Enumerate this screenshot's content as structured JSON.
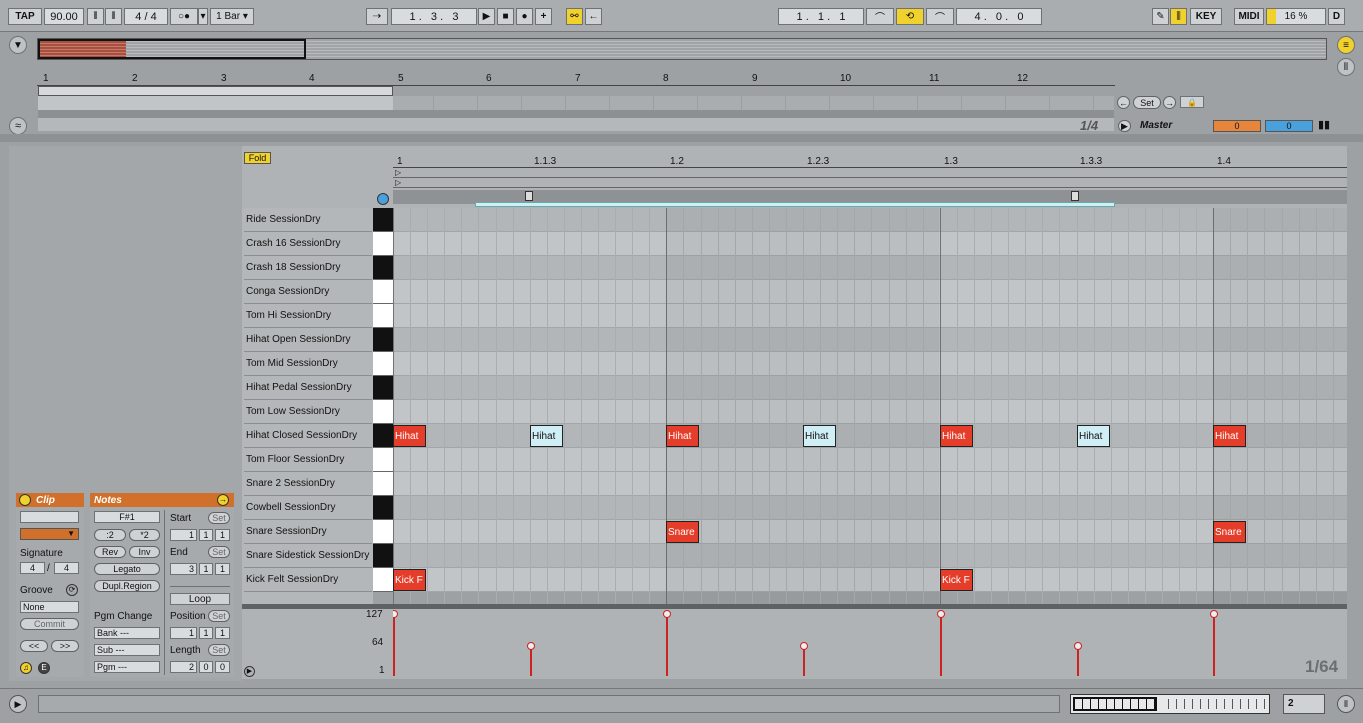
{
  "transport": {
    "tap": "TAP",
    "tempo": "90.00",
    "signature": "4 / 4",
    "quantize": "1 Bar",
    "song_position": "1 .   3 .   3",
    "loop_start": "1 .   1 .   1",
    "loop_length": "4 .   0 .   0",
    "key": "KEY",
    "midi": "MIDI",
    "cpu": "16 %",
    "d": "D"
  },
  "overview": {
    "ruler": [
      "1",
      "2",
      "3",
      "4",
      "5",
      "6",
      "7",
      "8",
      "9",
      "10",
      "11",
      "12"
    ],
    "set_button": "Set",
    "page": "1/4",
    "master": "Master",
    "master_value_a": "0",
    "master_value_b": "0"
  },
  "editor": {
    "fold": "Fold",
    "ruler": [
      "1",
      "1.1.3",
      "1.2",
      "1.2.3",
      "1.3",
      "1.3.3",
      "1.4"
    ],
    "keys": [
      {
        "name": "Ride SessionDry",
        "black": true
      },
      {
        "name": "Crash 16 SessionDry",
        "black": false
      },
      {
        "name": "Crash 18 SessionDry",
        "black": true
      },
      {
        "name": "Conga SessionDry",
        "black": false
      },
      {
        "name": "Tom Hi SessionDry",
        "black": false
      },
      {
        "name": "Hihat Open SessionDry",
        "black": true
      },
      {
        "name": "Tom Mid SessionDry",
        "black": false
      },
      {
        "name": "Hihat Pedal SessionDry",
        "black": true
      },
      {
        "name": "Tom Low SessionDry",
        "black": false
      },
      {
        "name": "Hihat Closed SessionDry",
        "black": true
      },
      {
        "name": "Tom Floor SessionDry",
        "black": false
      },
      {
        "name": "Snare 2 SessionDry",
        "black": false
      },
      {
        "name": "Cowbell SessionDry",
        "black": true
      },
      {
        "name": "Snare SessionDry",
        "black": false
      },
      {
        "name": "Snare Sidestick SessionDry",
        "black": true
      },
      {
        "name": "Kick Felt SessionDry",
        "black": false
      }
    ],
    "notes": [
      {
        "label": "Hihat",
        "row": 9,
        "step": 0,
        "color": "red"
      },
      {
        "label": "Hihat",
        "row": 9,
        "step": 2,
        "color": "light"
      },
      {
        "label": "Hihat",
        "row": 9,
        "step": 4,
        "color": "red"
      },
      {
        "label": "Hihat",
        "row": 9,
        "step": 6,
        "color": "light"
      },
      {
        "label": "Hihat",
        "row": 9,
        "step": 8,
        "color": "red"
      },
      {
        "label": "Hihat",
        "row": 9,
        "step": 10,
        "color": "light"
      },
      {
        "label": "Hihat",
        "row": 9,
        "step": 12,
        "color": "red"
      },
      {
        "label": "Snare",
        "row": 13,
        "step": 4,
        "color": "red"
      },
      {
        "label": "Snare",
        "row": 13,
        "step": 12,
        "color": "red"
      },
      {
        "label": "Kick F",
        "row": 15,
        "step": 0,
        "color": "red"
      },
      {
        "label": "Kick F",
        "row": 15,
        "step": 8,
        "color": "red"
      }
    ],
    "velocity": {
      "scale": [
        "127",
        "64",
        "1"
      ],
      "values": [
        127,
        64,
        127,
        64,
        127,
        64,
        127
      ]
    },
    "grid": "1/64"
  },
  "clip": {
    "title": "Clip",
    "signature_label": "Signature",
    "sig_num": "4",
    "sig_den": "4",
    "groove_label": "Groove",
    "groove_value": "None",
    "commit": "Commit",
    "prev": "<<",
    "next": ">>"
  },
  "notes_box": {
    "title": "Notes",
    "key": "F#1",
    "half": ":2",
    "double": "*2",
    "rev": "Rev",
    "inv": "Inv",
    "legato": "Legato",
    "dupl": "Dupl.Region",
    "pgm_change": "Pgm Change",
    "bank": "Bank ---",
    "sub": "Sub ---",
    "pgm": "Pgm ---",
    "start": "Start",
    "end": "End",
    "loop": "Loop",
    "position": "Position",
    "length": "Length",
    "set": "Set",
    "start_vals": [
      "1",
      "1",
      "1"
    ],
    "end_vals": [
      "3",
      "1",
      "1"
    ],
    "position_vals": [
      "1",
      "1",
      "1"
    ],
    "length_vals": [
      "2",
      "0",
      "0"
    ]
  },
  "status": {
    "track_num": "2"
  }
}
